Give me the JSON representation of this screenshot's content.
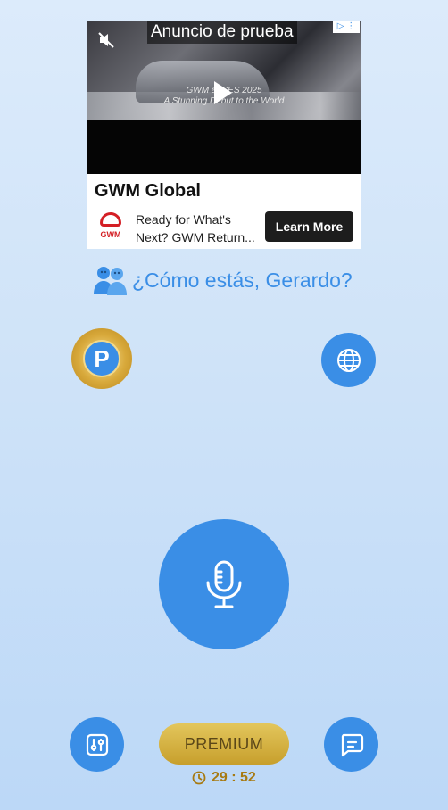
{
  "ad": {
    "label": "Anuncio de prueba",
    "video_text_line1": "GWM at CES 2025",
    "video_text_line2": "A Stunning Debut to the World",
    "title": "GWM Global",
    "logo_text": "GWM",
    "description": "Ready for What's Next? GWM Return...",
    "cta": "Learn More"
  },
  "greeting": "¿Cómo estás, Gerardo?",
  "premium_badge_letter": "P",
  "premium_button": "PREMIUM",
  "timer": "29 : 52",
  "colors": {
    "accent": "#3a8ee6",
    "gold": "#d4af37",
    "background": "#d2e6fa"
  },
  "icons": {
    "globe": "globe-icon",
    "mic": "microphone-icon",
    "settings": "sliders-icon",
    "chat": "chat-icon",
    "clock": "clock-icon"
  }
}
